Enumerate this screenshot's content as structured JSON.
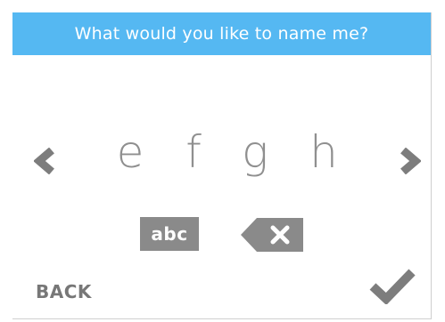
{
  "header": {
    "title": "What would you like to name me?"
  },
  "picker": {
    "letters": [
      "e",
      "f",
      "g",
      "h"
    ],
    "prev_icon": "chevron-left-icon",
    "next_icon": "chevron-right-icon"
  },
  "controls": {
    "abc_label": "abc",
    "backspace_icon": "backspace-icon",
    "back_label": "BACK",
    "confirm_icon": "checkmark-icon"
  },
  "colors": {
    "header_bg": "#55b8f2",
    "header_text": "#ffffff",
    "letter": "#8f8f8f",
    "control_bg": "#8a8a8a",
    "control_text": "#777777"
  }
}
